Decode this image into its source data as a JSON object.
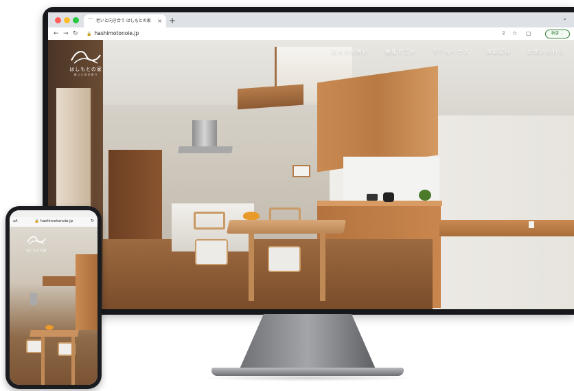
{
  "browser": {
    "tab_title": "老いと向き合う はしもとの家",
    "url": "hashimotonoie.jp",
    "new_button": "新版"
  },
  "site": {
    "logo_text": "はしもとの家",
    "logo_sub": "老いと向き合う",
    "nav": [
      {
        "label": "私たちの想い"
      },
      {
        "label": "機能と工夫"
      },
      {
        "label": "モデルハウス"
      },
      {
        "label": "建築実例"
      },
      {
        "label": "お問い合わせ"
      }
    ]
  },
  "phone": {
    "aa": "aA",
    "url": "hashimotonoie.jp",
    "logo_text": "はしもとの家"
  },
  "colors": {
    "traffic_red": "#ff5f57",
    "traffic_yellow": "#febc2e",
    "traffic_green": "#28c840",
    "new_button_green": "#2e7d32"
  }
}
